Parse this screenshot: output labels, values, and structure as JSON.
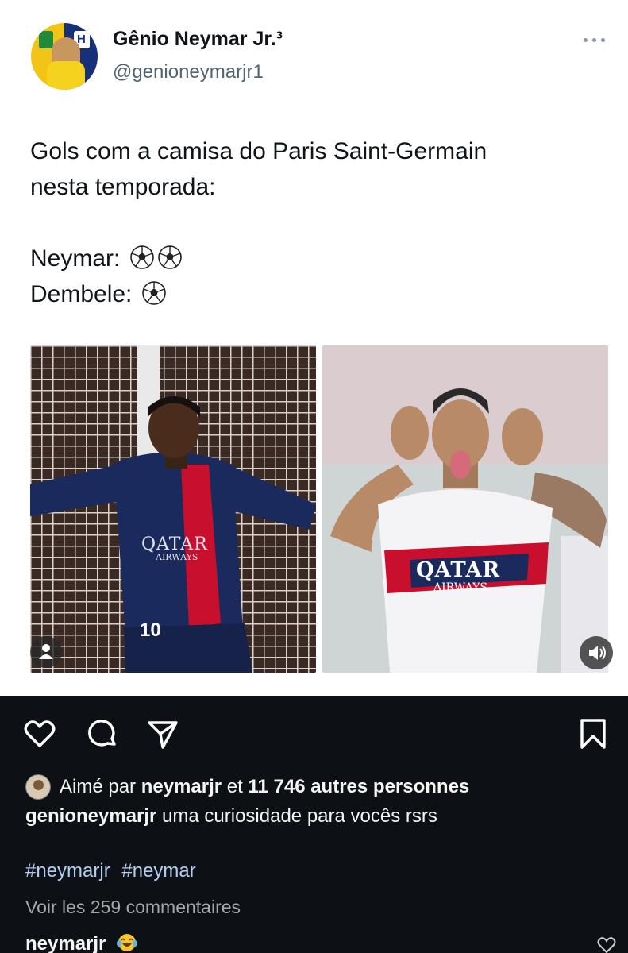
{
  "tweet": {
    "display_name": "Gênio Neymar Jr.³",
    "handle": "@genioneymarjr1",
    "text_line1": "Gols com a camisa do Paris Saint-Germain",
    "text_line2": "nesta temporada:",
    "players": [
      {
        "label": "Neymar:",
        "goals": 2
      },
      {
        "label": "Dembele:",
        "goals": 1
      }
    ],
    "icons": {
      "more": "more-dots-icon",
      "goal": "soccer-ball-icon",
      "person": "person-icon",
      "sound": "speaker-icon"
    },
    "photos": [
      {
        "description_icon": "person-icon",
        "text_on_shirt": "QATAR",
        "text_on_shirt_sub": "AIRWAYS",
        "shirt_number": "10",
        "shirt_color": "#1b2a5c"
      },
      {
        "description_icon": "speaker-icon",
        "text_on_shirt": "QATAR",
        "text_on_shirt_sub": "AIRWAYS",
        "shirt_color": "#f4f4f6"
      }
    ]
  },
  "instagram": {
    "liked_prefix": "Aimé par ",
    "liked_user": "neymarjr",
    "liked_middle": " et ",
    "liked_count_text": "11 746 autres personnes",
    "caption_user": "genioneymarjr",
    "caption_text": " uma curiosidade para vocês rsrs",
    "hashtags": [
      "#neymarjr",
      "#neymar"
    ],
    "view_comments": "Voir les 259 commentaires",
    "comment_user": "neymarjr",
    "icons": [
      "heart-icon",
      "comment-icon",
      "share-icon",
      "bookmark-icon"
    ],
    "colors": {
      "background": "#0d1014",
      "hashtag": "#b3cdf0",
      "muted": "#a8a8a8"
    }
  }
}
